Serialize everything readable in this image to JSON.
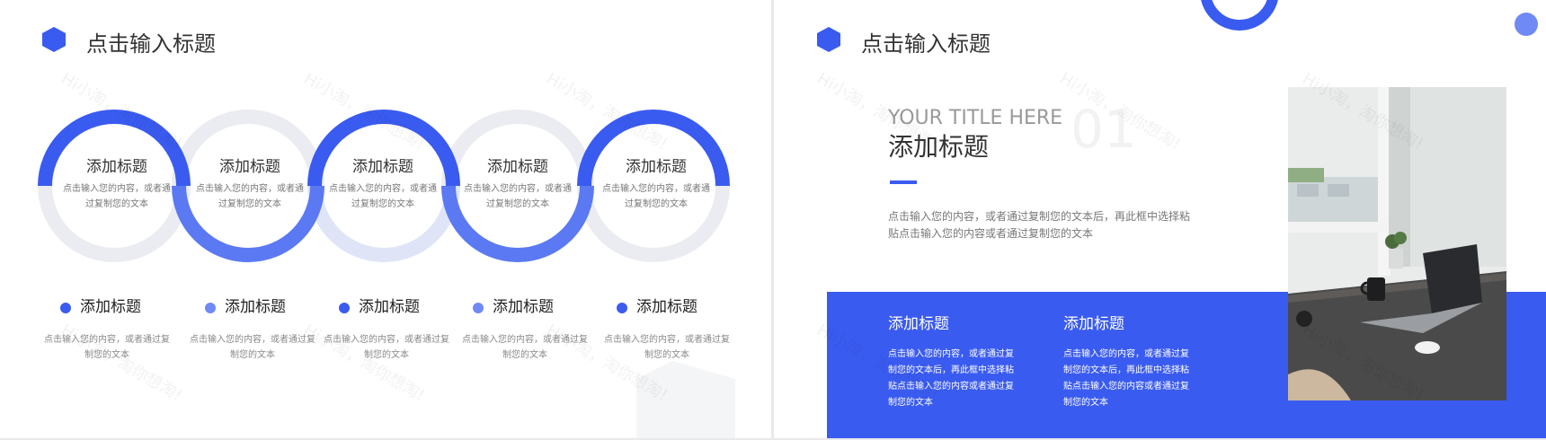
{
  "colors": {
    "accent": "#3a5bf0",
    "accent_light": "#6f8af4",
    "ring_gray": "#eaecf1",
    "text_dark": "#333333",
    "text_muted": "#888888"
  },
  "watermark": "Hi小淘，淘你想淘!",
  "left_slide": {
    "header": {
      "icon": "hexagon-icon",
      "title": "点击输入标题"
    },
    "rings": [
      {
        "title": "添加标题",
        "desc": "点击输入您的内容，或者通过复制您的文本"
      },
      {
        "title": "添加标题",
        "desc": "点击输入您的内容，或者通过复制您的文本"
      },
      {
        "title": "添加标题",
        "desc": "点击输入您的内容，或者通过复制您的文本"
      },
      {
        "title": "添加标题",
        "desc": "点击输入您的内容，或者通过复制您的文本"
      },
      {
        "title": "添加标题",
        "desc": "点击输入您的内容，或者通过复制您的文本"
      }
    ],
    "bullets": [
      {
        "title": "添加标题",
        "desc": "点击输入您的内容，或者通过复制您的文本"
      },
      {
        "title": "添加标题",
        "desc": "点击输入您的内容，或者通过复制您的文本"
      },
      {
        "title": "添加标题",
        "desc": "点击输入您的内容，或者通过复制您的文本"
      },
      {
        "title": "添加标题",
        "desc": "点击输入您的内容，或者通过复制您的文本"
      },
      {
        "title": "添加标题",
        "desc": "点击输入您的内容，或者通过复制您的文本"
      }
    ]
  },
  "right_slide": {
    "header": {
      "icon": "hexagon-icon",
      "title": "点击输入标题"
    },
    "subtitle_en": "YOUR TITLE HERE",
    "number": "01",
    "title": "添加标题",
    "body": "点击输入您的内容，或者通过复制您的文本后，再此框中选择粘贴点击输入您的内容或者通过复制您的文本",
    "cards": [
      {
        "title": "添加标题",
        "desc": "点击输入您的内容，或者通过复制您的文本后，再此框中选择粘贴点击输入您的内容或者通过复制您的文本"
      },
      {
        "title": "添加标题",
        "desc": "点击输入您的内容，或者通过复制您的文本后，再此框中选择粘贴点击输入您的内容或者通过复制您的文本"
      }
    ],
    "photo": "desk-laptop-photo"
  }
}
